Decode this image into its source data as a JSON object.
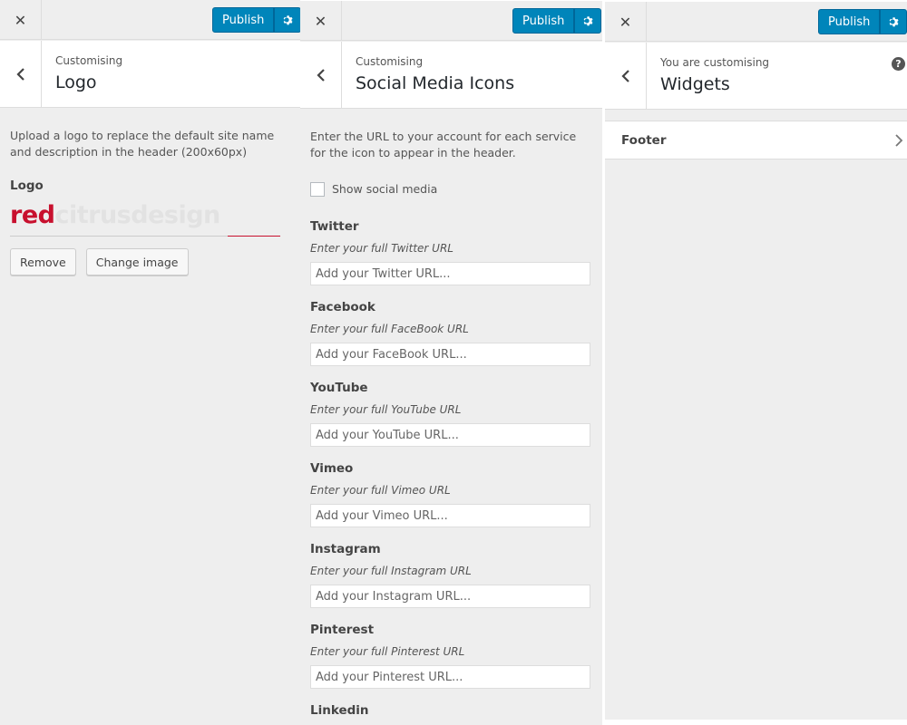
{
  "panels": [
    {
      "close_icon": "close-icon",
      "publish_label": "Publish",
      "breadcrumb": "Customising",
      "title": "Logo",
      "description": "Upload a logo to replace the default site name and description in the header (200x60px)",
      "control_title": "Logo",
      "logo": {
        "red_part": "red",
        "grey_part": "citrusdesign"
      },
      "remove_label": "Remove",
      "change_label": "Change image"
    },
    {
      "publish_label": "Publish",
      "breadcrumb": "Customising",
      "title": "Social Media Icons",
      "description": "Enter the URL to your account for each service for the icon to appear in the header.",
      "show_social_label": "Show social media",
      "show_social_checked": false,
      "services": [
        {
          "title": "Twitter",
          "desc": "Enter your full Twitter URL",
          "placeholder": "Add your Twitter URL..."
        },
        {
          "title": "Facebook",
          "desc": "Enter your full FaceBook URL",
          "placeholder": "Add your FaceBook URL..."
        },
        {
          "title": "YouTube",
          "desc": "Enter your full YouTube URL",
          "placeholder": "Add your YouTube URL..."
        },
        {
          "title": "Vimeo",
          "desc": "Enter your full Vimeo URL",
          "placeholder": "Add your Vimeo URL..."
        },
        {
          "title": "Instagram",
          "desc": "Enter your full Instagram URL",
          "placeholder": "Add your Instagram URL..."
        },
        {
          "title": "Pinterest",
          "desc": "Enter your full Pinterest URL",
          "placeholder": "Add your Pinterest URL..."
        },
        {
          "title": "Linkedin"
        }
      ]
    },
    {
      "publish_label": "Publish",
      "breadcrumb": "You are customising",
      "title": "Widgets",
      "help_label": "?",
      "sections": [
        {
          "label": "Footer"
        }
      ]
    }
  ],
  "colors": {
    "accent": "#0085ba",
    "logo_red": "#c8102e",
    "panel_bg": "#eeeeee"
  }
}
